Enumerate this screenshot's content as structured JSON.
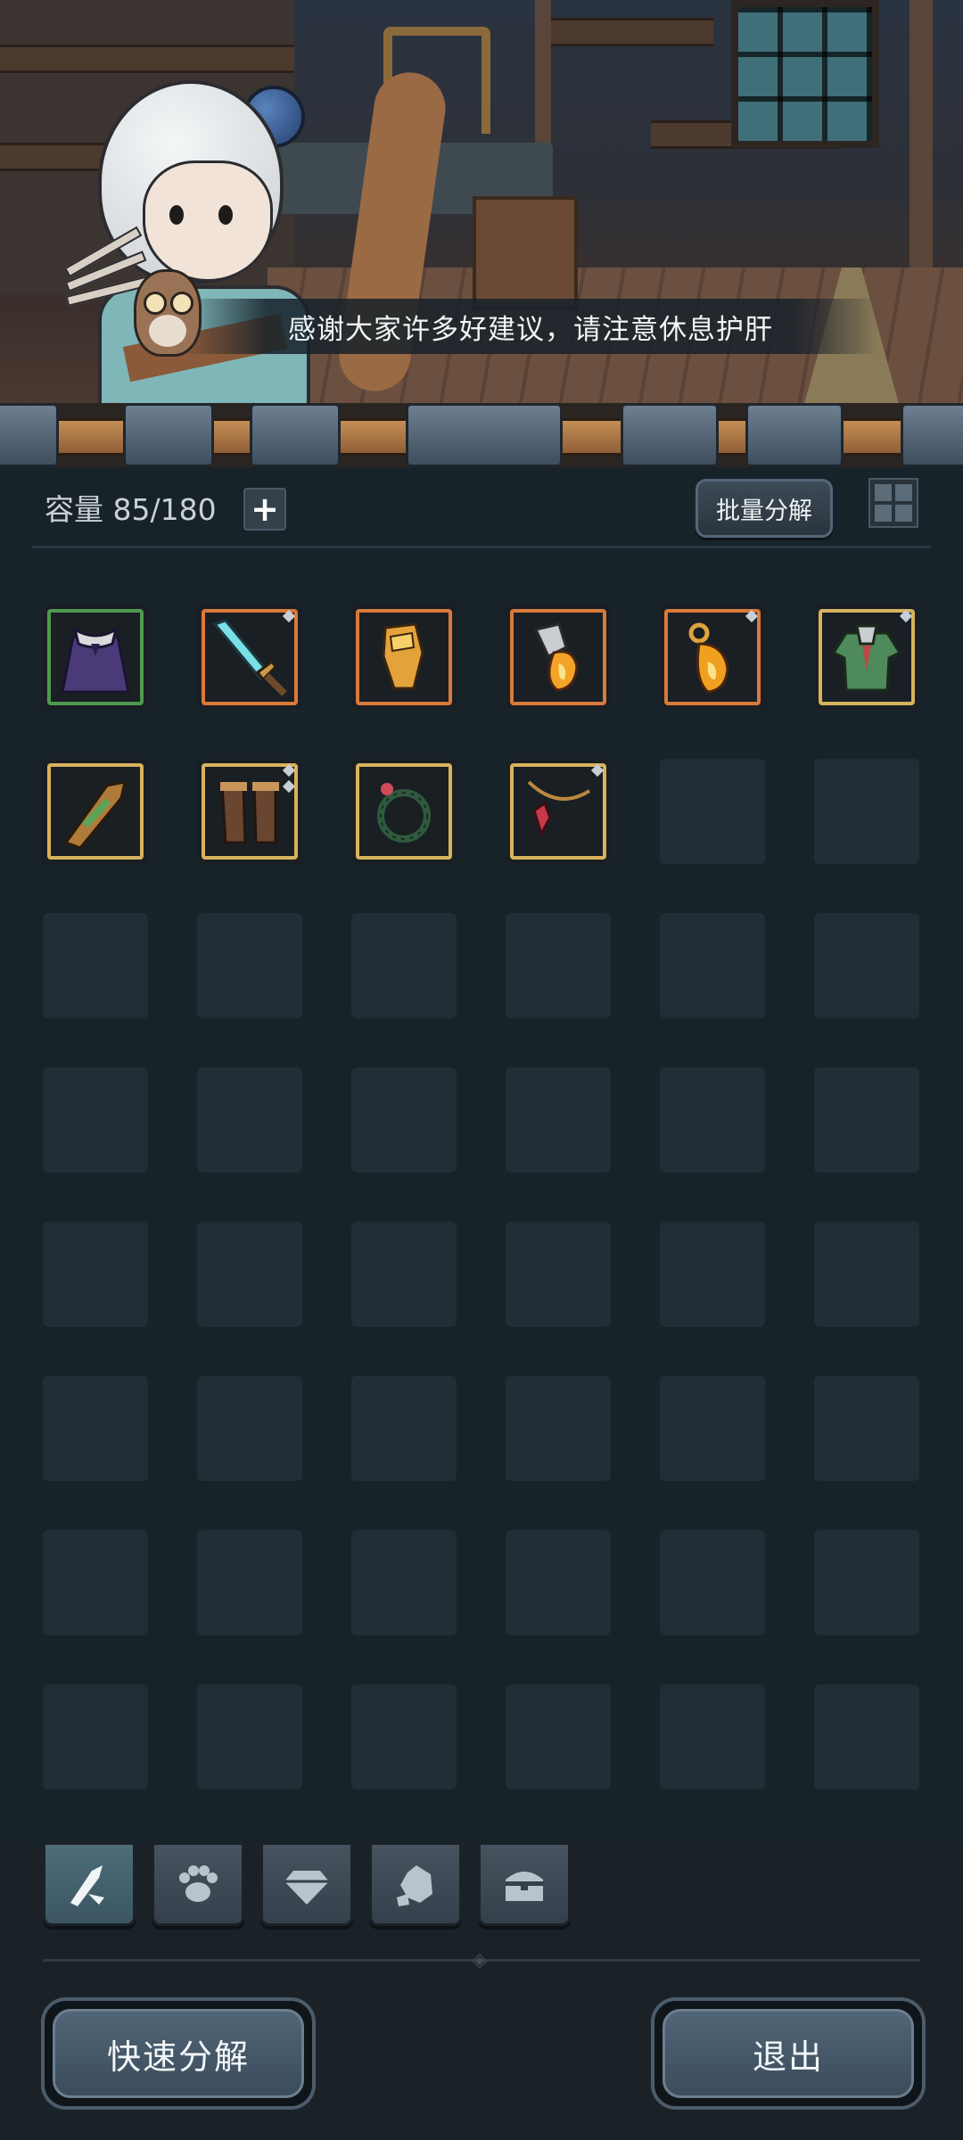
{
  "scene": {
    "banner_text": "感谢大家许多好建议，请注意休息护肝"
  },
  "inventory": {
    "capacity_label": "容量",
    "capacity_value": "85/180",
    "add_icon": "plus-icon",
    "batch_button": "批量分解",
    "grid_view_icon": "grid-view-icon",
    "items": [
      {
        "name": "cloak",
        "frame": "#4f9a4f"
      },
      {
        "name": "sword",
        "frame": "#d9793a"
      },
      {
        "name": "gauntlet",
        "frame": "#d9793a"
      },
      {
        "name": "fire-gauntlet",
        "frame": "#d9793a"
      },
      {
        "name": "fire-amulet",
        "frame": "#d9793a"
      },
      {
        "name": "tunic",
        "frame": "#d8b35e"
      },
      {
        "name": "bracer",
        "frame": "#d8b35e"
      },
      {
        "name": "boots",
        "frame": "#d8b35e"
      },
      {
        "name": "thorn-ring",
        "frame": "#d8b35e"
      },
      {
        "name": "necklace",
        "frame": "#d8b35e"
      }
    ],
    "empty_slots": 38
  },
  "tabs": [
    {
      "icon": "equipment-icon",
      "active": true
    },
    {
      "icon": "paw-icon",
      "active": false
    },
    {
      "icon": "diamond-icon",
      "active": false
    },
    {
      "icon": "ore-icon",
      "active": false
    },
    {
      "icon": "chest-icon",
      "active": false
    }
  ],
  "buttons": {
    "quick_decompose": "快速分解",
    "exit": "退出"
  },
  "colors": {
    "background": "#182229",
    "slot": "#222d35",
    "rare_frame": "#d9793a",
    "common_frame": "#d8b35e",
    "uncommon_frame": "#4f9a4f"
  }
}
